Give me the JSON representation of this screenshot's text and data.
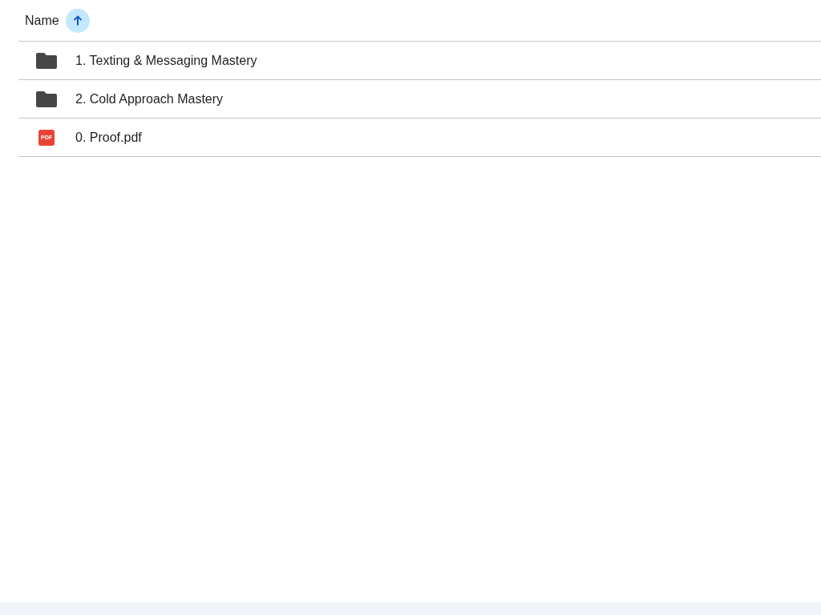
{
  "header": {
    "label": "Name",
    "ascending": true
  },
  "items": [
    {
      "kind": "folder",
      "name": "1. Texting & Messaging Mastery"
    },
    {
      "kind": "folder",
      "name": "2. Cold Approach Mastery"
    },
    {
      "kind": "pdf",
      "name": "0. Proof.pdf",
      "icon_text": "PDF"
    }
  ]
}
